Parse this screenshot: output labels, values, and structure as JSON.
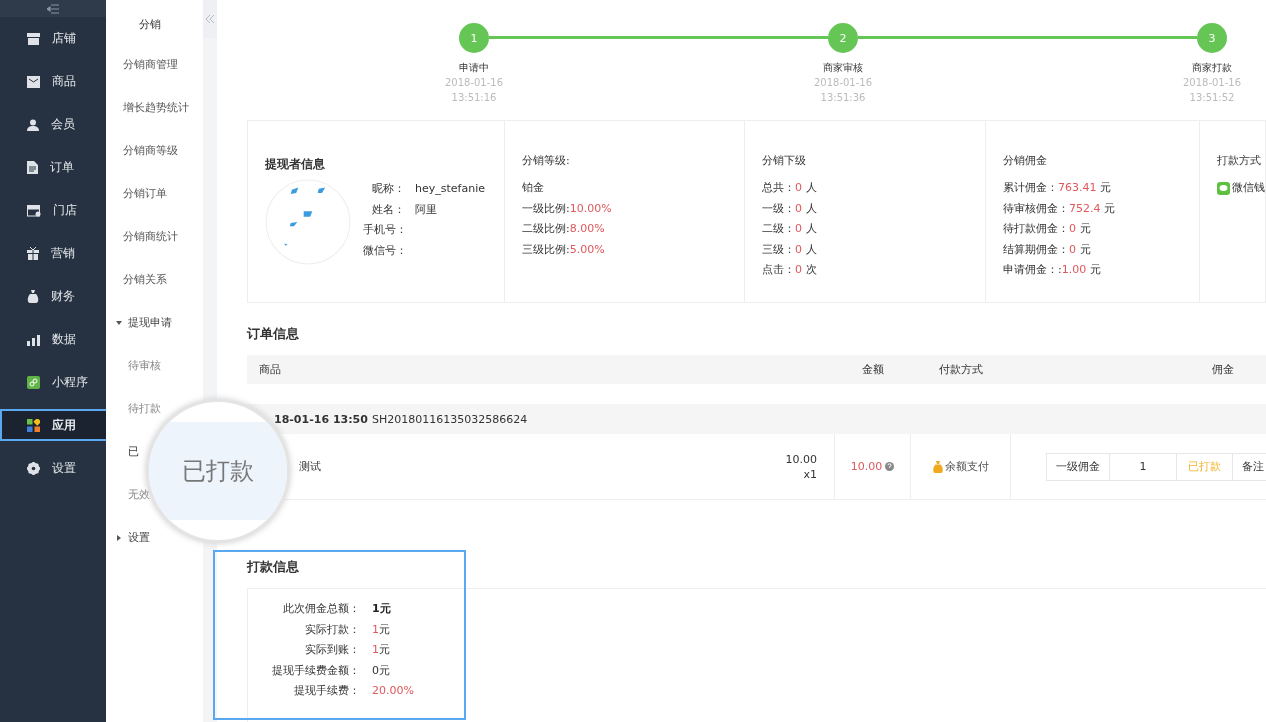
{
  "nav": {
    "items": [
      {
        "label": "店铺",
        "selected": false
      },
      {
        "label": "商品",
        "selected": false
      },
      {
        "label": "会员",
        "selected": false
      },
      {
        "label": "订单",
        "selected": false
      },
      {
        "label": "门店",
        "selected": false
      },
      {
        "label": "营销",
        "selected": false
      },
      {
        "label": "财务",
        "selected": false
      },
      {
        "label": "数据",
        "selected": false
      },
      {
        "label": "小程序",
        "selected": false
      },
      {
        "label": "应用",
        "selected": true
      },
      {
        "label": "设置",
        "selected": false
      }
    ]
  },
  "submenu": {
    "title": "分销",
    "items": [
      {
        "label": "分销商管理",
        "kind": "link"
      },
      {
        "label": "增长趋势统计",
        "kind": "link"
      },
      {
        "label": "分销商等级",
        "kind": "link"
      },
      {
        "label": "分销订单",
        "kind": "link"
      },
      {
        "label": "分销商统计",
        "kind": "link"
      },
      {
        "label": "分销关系",
        "kind": "link"
      },
      {
        "label": "提现申请",
        "kind": "group",
        "expanded": true,
        "children": [
          {
            "label": "待审核",
            "selected": false
          },
          {
            "label": "待打款",
            "selected": false
          },
          {
            "label": "已",
            "selected": true
          },
          {
            "label": "无效",
            "selected": false
          }
        ]
      },
      {
        "label": "设置",
        "kind": "group",
        "expanded": false
      }
    ]
  },
  "steps": [
    {
      "number": "1",
      "label": "申请中",
      "date": "2018-01-16",
      "time": "13:51:16",
      "done": true
    },
    {
      "number": "2",
      "label": "商家审核",
      "date": "2018-01-16",
      "time": "13:51:36",
      "done": true
    },
    {
      "number": "3",
      "label": "商家打款",
      "date": "2018-01-16",
      "time": "13:51:52",
      "done": true
    }
  ],
  "withdrawer": {
    "title": "提现者信息",
    "fields": [
      {
        "label": "昵称：",
        "value": "hey_stefanie"
      },
      {
        "label": "姓名：",
        "value": "阿里"
      },
      {
        "label": "手机号："
      },
      {
        "label": "微信号："
      }
    ]
  },
  "grade_info": {
    "title": "分销等级:",
    "grade": "铂金",
    "rows": [
      {
        "label": "一级比例:",
        "value": "10.00%"
      },
      {
        "label": "二级比例:",
        "value": "8.00%"
      },
      {
        "label": "三级比例:",
        "value": "5.00%"
      }
    ]
  },
  "subordinates": {
    "title": "分销下级",
    "rows": [
      {
        "label": "总共：",
        "value": "0",
        "unit": "人"
      },
      {
        "label": "一级：",
        "value": "0",
        "unit": "人"
      },
      {
        "label": "二级：",
        "value": "0",
        "unit": "人"
      },
      {
        "label": "三级：",
        "value": "0",
        "unit": "人"
      },
      {
        "label": "点击：",
        "value": "0",
        "unit": "次"
      }
    ]
  },
  "commission": {
    "title": "分销佣金",
    "rows": [
      {
        "label": "累计佣金：",
        "value": "763.41",
        "unit": "元"
      },
      {
        "label": "待审核佣金：",
        "value": "752.4",
        "unit": "元"
      },
      {
        "label": "待打款佣金：",
        "value": "0",
        "unit": "元"
      },
      {
        "label": "结算期佣金：",
        "value": "0",
        "unit": "元"
      },
      {
        "label": "申请佣金：:",
        "value": "1.00",
        "unit": "元"
      }
    ]
  },
  "payment_method": {
    "title": "打款方式",
    "method": "微信钱"
  },
  "order_info": {
    "title": "订单信息",
    "columns": [
      "商品",
      "金额",
      "付款方式",
      "佣金"
    ],
    "orders": [
      {
        "time": "18-01-16 13:50",
        "order_no": "SH20180116135032586624",
        "items": [
          {
            "name": "测试",
            "price": "10.00",
            "quantity": "x1",
            "amount": "10.00",
            "payment": "余额支付",
            "commission": {
              "label": "一级佣金",
              "value": "1",
              "status": "已打款",
              "note": "备注"
            }
          }
        ]
      }
    ]
  },
  "payout_info": {
    "title": "打款信息",
    "highlighted": true,
    "rows": [
      {
        "label": "此次佣金总额：",
        "value": "1元",
        "kind": "bold"
      },
      {
        "label": "实际打款：",
        "value": "1",
        "unit": "元",
        "kind": "accent"
      },
      {
        "label": "实际到账：",
        "value": "1",
        "unit": "元",
        "kind": "accent"
      },
      {
        "label": "提现手续费金额：",
        "value": "0",
        "unit": "元",
        "kind": "plain"
      },
      {
        "label": "提现手续费：",
        "value": "20.00%",
        "kind": "accent"
      }
    ]
  },
  "magnifier": {
    "text": "已打款"
  }
}
